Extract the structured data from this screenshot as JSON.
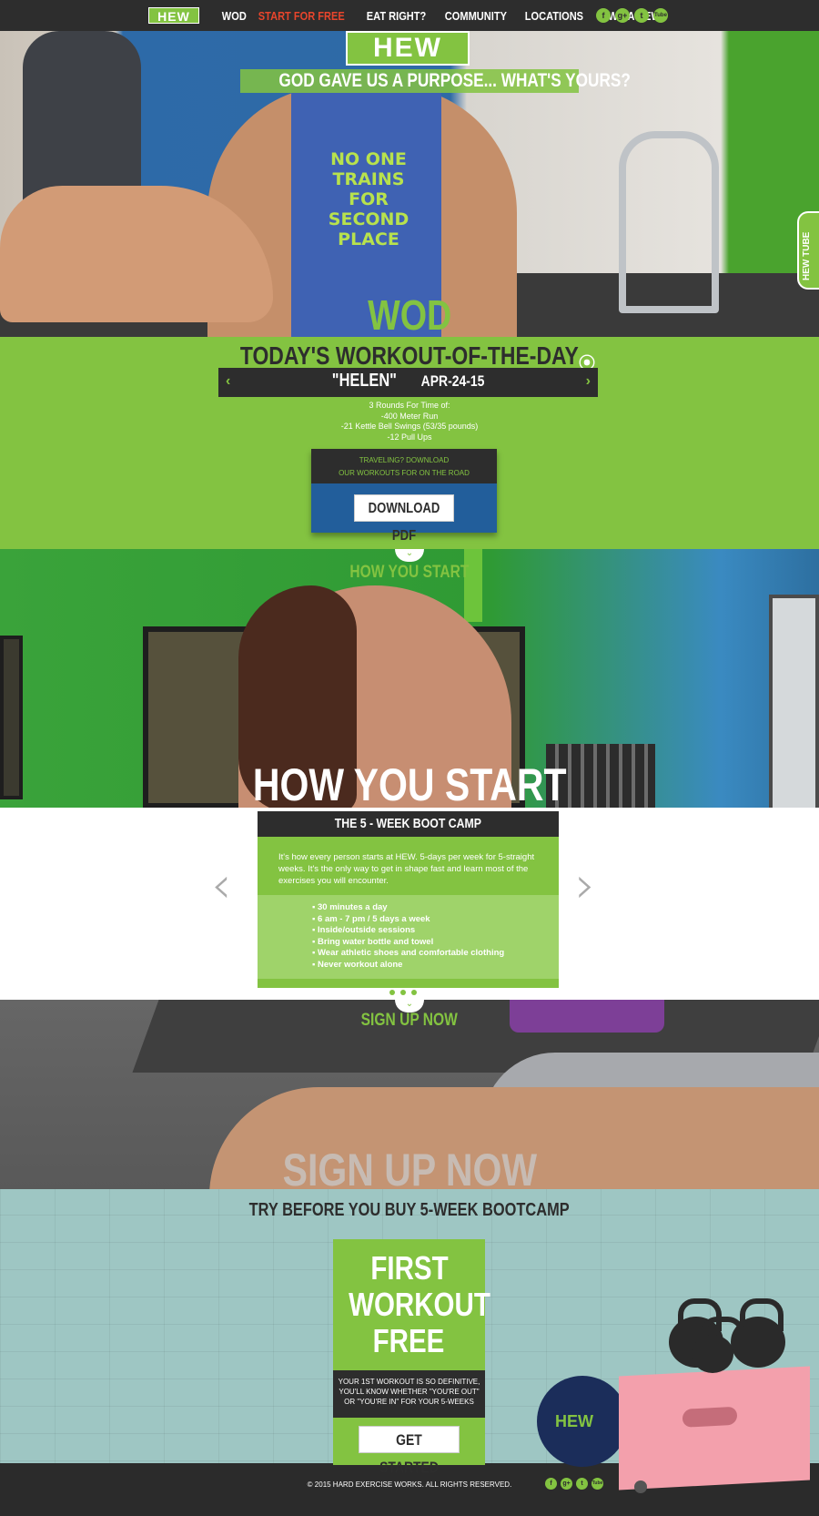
{
  "nav": {
    "logo": "HEW",
    "links": [
      {
        "label": "WOD",
        "active": false
      },
      {
        "label": "START FOR FREE",
        "active": true
      },
      {
        "label": "EAT RIGHT?",
        "active": false
      },
      {
        "label": "COMMUNITY",
        "active": false
      },
      {
        "label": "LOCATIONS",
        "active": false
      },
      {
        "label": "OWN A HEW",
        "active": false
      }
    ],
    "social": [
      {
        "icon": "facebook-icon",
        "glyph": "f"
      },
      {
        "icon": "google-plus-icon",
        "glyph": "g+"
      },
      {
        "icon": "twitter-icon",
        "glyph": "t"
      },
      {
        "icon": "youtube-icon",
        "glyph": "Tube"
      }
    ]
  },
  "hero": {
    "logo": "HEW",
    "tagline": "GOD GAVE US A PURPOSE... WHAT'S YOURS?",
    "shirt_text": "NO ONE TRAINS FOR SECOND PLACE",
    "side_tab": "HEW TUBE",
    "section_label": "WOD"
  },
  "wod": {
    "title": "TODAY'S WORKOUT-OF-THE-DAY",
    "prev": "‹",
    "next": "›",
    "workout_name": "\"HELEN\"",
    "workout_date": "APR-24-15",
    "lines": [
      "3 Rounds For Time of:",
      "-400 Meter Run",
      "-21 Kettle Bell Swings (53/35 pounds)",
      "-12 Pull Ups"
    ],
    "download_text_1": "TRAVELING? DOWNLOAD",
    "download_text_2": "OUR WORKOUTS FOR ON THE ROAD",
    "download_button": "DOWNLOAD PDF"
  },
  "how": {
    "small_title": "HOW YOU START",
    "big_title": "HOW YOU START"
  },
  "bootcamp": {
    "header": "THE 5 - WEEK BOOT CAMP",
    "description": "It's how every person starts at HEW. 5-days per week for 5-straight weeks. It's the only way to get in shape fast and learn most of the exercises you will encounter.",
    "bullets": [
      "30 minutes a day",
      "6 am - 7 pm / 5 days a week",
      "Inside/outside sessions",
      "Bring water bottle and towel",
      "Wear athletic shoes and comfortable clothing",
      "Never workout alone"
    ],
    "prev": "‹",
    "next": "›"
  },
  "signup": {
    "small_title": "SIGN UP NOW",
    "big_title": "SIGN UP NOW"
  },
  "trial": {
    "title": "TRY BEFORE YOU BUY 5-WEEK BOOTCAMP",
    "offer_lines": [
      "FIRST",
      "WORKOUT",
      "FREE"
    ],
    "offer_text": [
      "YOUR 1ST WORKOUT IS SO DEFINITIVE,",
      "YOU'LL KNOW WHETHER \"YOU'RE OUT\"",
      "OR \"YOU'RE IN\" FOR YOUR 5-WEEKS"
    ],
    "button": "GET STARTED",
    "ball_logo": "HEW"
  },
  "footer": {
    "copyright": "© 2015 HARD EXERCISE WORKS. ALL RIGHTS RESERVED."
  },
  "colors": {
    "brand_green": "#83c341",
    "dark": "#2d2d2d",
    "active_nav": "#e8452c",
    "download_blue": "#225e9b"
  }
}
